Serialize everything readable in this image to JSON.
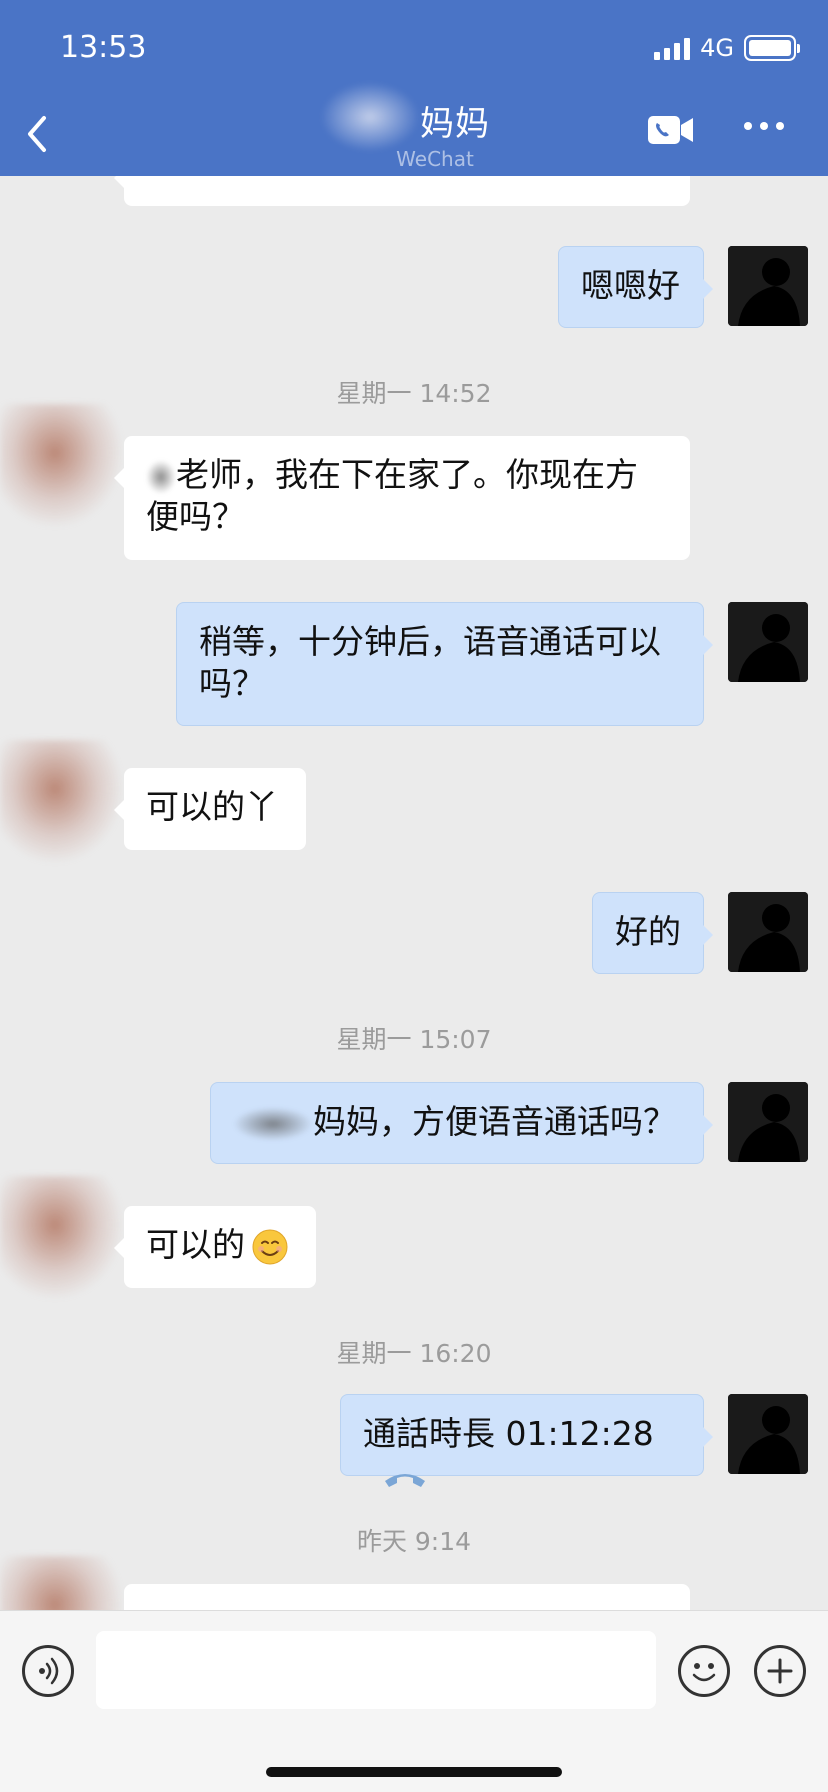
{
  "status": {
    "time": "13:53",
    "network": "4G"
  },
  "header": {
    "title": "妈妈",
    "subtitle": "WeChat"
  },
  "messages": [
    {
      "kind": "in",
      "text": "",
      "partial": true
    },
    {
      "kind": "out",
      "text": "嗯嗯好"
    },
    {
      "kind": "time",
      "text": "星期一 14:52"
    },
    {
      "kind": "in",
      "text_prefix": "老师，我在下在家了。你现在方",
      "text_suffix": "便吗？"
    },
    {
      "kind": "out",
      "line1": "稍等，十分钟后，语音通话可以",
      "line2": "吗？"
    },
    {
      "kind": "in",
      "text": "可以的丫"
    },
    {
      "kind": "out",
      "text": "好的"
    },
    {
      "kind": "time",
      "text": "星期一 15:07"
    },
    {
      "kind": "out",
      "text": "妈妈，方便语音通话吗？"
    },
    {
      "kind": "in",
      "text": "可以的"
    },
    {
      "kind": "time",
      "text": "星期一 16:20"
    },
    {
      "kind": "out",
      "text": "通話時長 01:12:28"
    },
    {
      "kind": "time",
      "text": "昨天 9:14"
    }
  ],
  "icons": {
    "back": "chevron-left-icon",
    "call": "video-call-icon",
    "more": "more-icon",
    "voice": "voice-input-icon",
    "emoji": "emoji-icon",
    "plus": "plus-icon",
    "phone": "phone-hangup-icon"
  },
  "colors": {
    "header": "#4a74c6",
    "outgoing_bubble": "#cfe2fb",
    "incoming_bubble": "#ffffff",
    "background": "#ebebeb"
  }
}
